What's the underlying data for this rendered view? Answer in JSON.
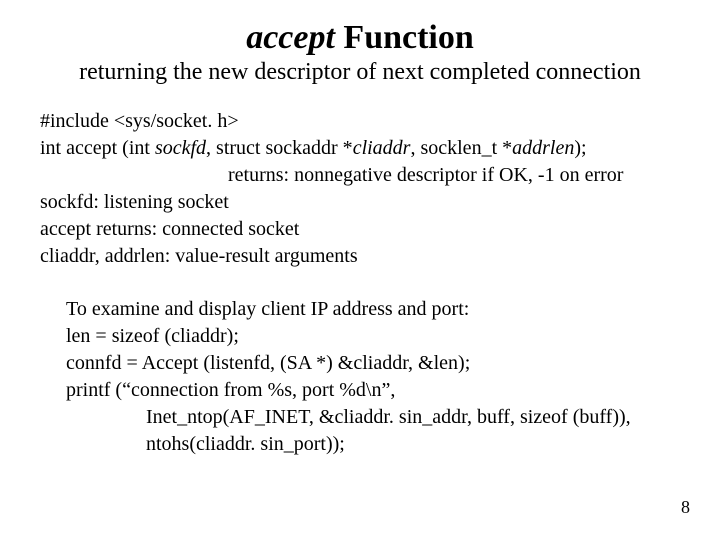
{
  "title": {
    "func": "accept",
    "rest": " Function"
  },
  "subtitle": "returning the new descriptor of next completed connection",
  "block1": {
    "include": "#include <sys/socket. h>",
    "proto_prefix": "int accept (int ",
    "proto_sockfd": "sockfd",
    "proto_mid1": ", struct sockaddr *",
    "proto_cliaddr": "cliaddr",
    "proto_mid2": ", socklen_t *",
    "proto_addrlen": "addrlen",
    "proto_end": ");",
    "returns": "returns: nonnegative descriptor if OK, -1 on error",
    "l4": "sockfd: listening socket",
    "l5": "accept returns: connected socket",
    "l6": "cliaddr, addrlen: value-result arguments"
  },
  "block2": {
    "l1": "To examine and display client IP address and port:",
    "l2": "len = sizeof (cliaddr);",
    "l3": "connfd = Accept (listenfd, (SA *) &cliaddr, &len);",
    "l4": "printf (“connection from %s, port %d\\n”,",
    "l5": "Inet_ntop(AF_INET, &cliaddr. sin_addr, buff, sizeof (buff)),",
    "l6": "ntohs(cliaddr. sin_port));"
  },
  "pagenum": "8"
}
